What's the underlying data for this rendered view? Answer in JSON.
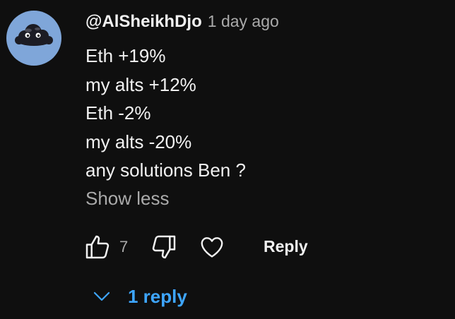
{
  "comment": {
    "author": "@AlSheikhDjo",
    "timestamp": "1 day ago",
    "lines": [
      "Eth +19%",
      "my alts +12%",
      "Eth -2%",
      "my alts -20%",
      "any solutions Ben ?"
    ],
    "show_less_label": "Show less",
    "avatar_icon": "storm-cloud-avatar-icon"
  },
  "actions": {
    "like_icon": "thumbs-up-icon",
    "like_count": "7",
    "dislike_icon": "thumbs-down-icon",
    "heart_icon": "heart-icon",
    "reply_label": "Reply"
  },
  "replies": {
    "toggle_icon": "chevron-down-icon",
    "label": "1 reply"
  },
  "colors": {
    "background": "#0f0f0f",
    "text": "#f1f1f1",
    "secondary_text": "#aaaaaa",
    "link": "#3ea6ff",
    "avatar_background": "#7fa6d9"
  }
}
